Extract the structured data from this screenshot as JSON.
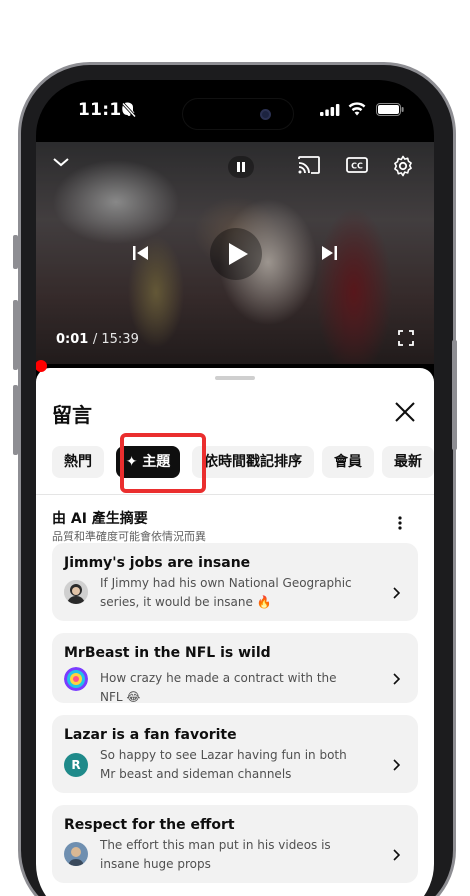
{
  "status_bar": {
    "time": "11:10"
  },
  "video": {
    "current_time": "0:01",
    "duration": "/ 15:39"
  },
  "comments": {
    "title": "留言",
    "chips": [
      {
        "label": "熱門",
        "active": false
      },
      {
        "label": "✦ 主題",
        "active": true
      },
      {
        "label": "依時間戳記排序",
        "active": false
      },
      {
        "label": "會員",
        "active": false
      },
      {
        "label": "最新",
        "active": false
      }
    ],
    "ai_summary": {
      "title": "由 AI 產生摘要",
      "disclaimer": "品質和準確度可能會依情況而異"
    },
    "topics": [
      {
        "title": "Jimmy's jobs are insane",
        "text": "If Jimmy had his own National Geographic series, it would be insane 🔥",
        "avatar": "jimmy-avatar"
      },
      {
        "title": "MrBeast in the NFL is wild",
        "text": "How crazy he made a contract with the NFL 😂",
        "avatar": "colorful-avatar"
      },
      {
        "title": "Lazar is a fan favorite",
        "text": "So happy to see Lazar having fun in both Mr beast and sideman channels",
        "avatar": "R"
      },
      {
        "title": "Respect for the effort",
        "text": "The effort this man put in his videos is insane huge props",
        "avatar": "person-avatar"
      }
    ]
  },
  "colors": {
    "accent_red": "#ff0000",
    "highlight": "#ea2e2e",
    "chip_bg": "#f2f2f2",
    "chip_active_bg": "#0f0f0f"
  }
}
